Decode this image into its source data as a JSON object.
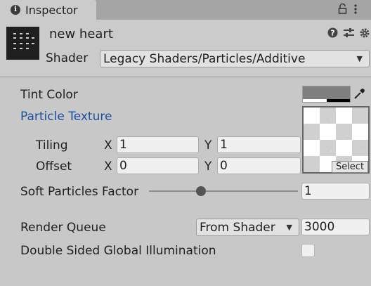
{
  "tab": {
    "title": "Inspector"
  },
  "header": {
    "object_name": "new heart",
    "shader_label": "Shader",
    "shader_value": "Legacy Shaders/Particles/Additive"
  },
  "properties": {
    "tint_color_label": "Tint Color",
    "tint_color": "#7f7f7f",
    "particle_texture_label": "Particle Texture",
    "tiling_label": "Tiling",
    "tiling_x": "1",
    "tiling_y": "1",
    "offset_label": "Offset",
    "offset_x": "0",
    "offset_y": "0",
    "x_axis": "X",
    "y_axis": "Y",
    "select_label": "Select",
    "soft_particles_label": "Soft Particles Factor",
    "soft_particles_value": "1",
    "soft_particles_slider_fraction": 0.35,
    "render_queue_label": "Render Queue",
    "render_queue_mode": "From Shader",
    "render_queue_value": "3000",
    "double_sided_gi_label": "Double Sided Global Illumination",
    "double_sided_gi_checked": false
  },
  "icons": [
    "info-icon",
    "lock-icon",
    "more-icon",
    "thumbnail-icon",
    "help-icon",
    "preset-icon",
    "settings-icon",
    "color-picker-icon",
    "dropdown-caret-icon"
  ],
  "colors": {
    "link_blue": "#1c4fa0",
    "panel_bg": "#c8c8c8"
  }
}
